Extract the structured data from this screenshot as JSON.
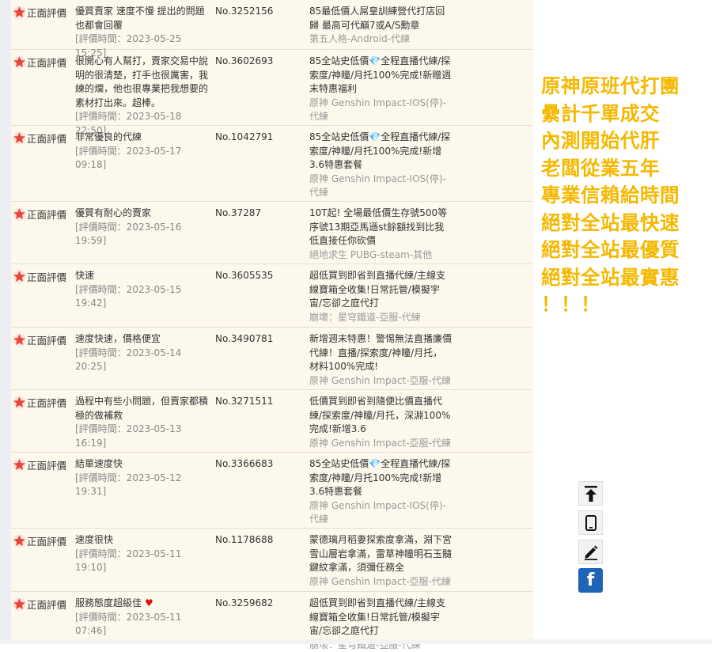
{
  "reviews": [
    {
      "rating": "正面評價",
      "comment": "優質賣家 速度不慢 提出的問題也都會回覆",
      "time": "[評價時間：2023-05-25 15:25]",
      "order_no": "No.3252156",
      "product_title": "85最低價人屌皇訓練營代打店回歸 最高可代巔7或A/S勳章",
      "product_game": "第五人格-Android-代練"
    },
    {
      "rating": "正面評價",
      "comment": "很開心有人幫打，賣家交易中說明的很清楚，打手也很厲害，我練的爛，他也很專業把我想要的素材打出來。超棒。",
      "time": "[評價時間：2023-05-18 22:50]",
      "order_no": "No.3602693",
      "product_title": "85全站史低價💎全程直播代練/探索度/神瞳/月托100%完成!新贈週末特惠福利",
      "product_game": "原神 Genshin Impact-IOS(停)-代練"
    },
    {
      "rating": "正面評價",
      "comment": "非常優良的代練",
      "time": "[評價時間：2023-05-17 09:18]",
      "order_no": "No.1042791",
      "product_title": "85全站史低價💎全程直播代練/探索度/神瞳/月托100%完成!新增3.6特惠套餐",
      "product_game": "原神 Genshin Impact-IOS(停)-代練"
    },
    {
      "rating": "正面評價",
      "comment": "優質有耐心的賣家",
      "time": "[評價時間：2023-05-16 19:59]",
      "order_no": "No.37287",
      "product_title": "10T起! 全場最低價生存號500等序號13期亞馬遜st餘額找到比我低直接任你砍價",
      "product_game": "絕地求生 PUBG-steam-其他"
    },
    {
      "rating": "正面評價",
      "comment": "快速",
      "time": "[評價時間：2023-05-15 19:42]",
      "order_no": "No.3605535",
      "product_title": "超低買到即省到直播代練/主線支線寶箱全收集!日常託管/模擬宇宙/忘卻之庭代打",
      "product_game": "崩壞：星穹鐵道-亞服-代練"
    },
    {
      "rating": "正面評價",
      "comment": "速度快速，價格便宜",
      "time": "[評價時間：2023-05-14 20:25]",
      "order_no": "No.3490781",
      "product_title": "新增週末特惠！警惕無法直播廉價代練！直播/探索度/神瞳/月托，材料100%完成!",
      "product_game": "原神 Genshin Impact-亞服-代練"
    },
    {
      "rating": "正面評價",
      "comment": "過程中有些小問題，但賣家都積極的做補救",
      "time": "[評價時間：2023-05-13 16:19]",
      "order_no": "No.3271511",
      "product_title": "低價買到即省到隨便比價直播代練/探索度/神瞳/月托，深淵100%完成!新增3.6",
      "product_game": "原神 Genshin Impact-亞服-代練"
    },
    {
      "rating": "正面評價",
      "comment": "結單速度快",
      "time": "[評價時間：2023-05-12 19:31]",
      "order_no": "No.3366683",
      "product_title": "85全站史低價💎全程直播代練/探索度/神瞳/月托100%完成!新增3.6特惠套餐",
      "product_game": "原神 Genshin Impact-IOS(停)-代練"
    },
    {
      "rating": "正面評價",
      "comment": "速度很快",
      "time": "[評價時間：2023-05-11 19:10]",
      "order_no": "No.1178688",
      "product_title": "蒙德璃月稻妻探索度拿滿，淵下宮雪山層岩拿滿，雷草神瞳明石玉髓鍵紋拿滿，須彌任務全",
      "product_game": "原神 Genshin Impact-亞服-代練"
    },
    {
      "rating": "正面評價",
      "comment": "服務態度超級佳",
      "time": "[評價時間：2023-05-11 07:46]",
      "order_no": "No.3259682",
      "product_title": "超低買到即省到直播代練/主線支線寶箱全收集!日常託管/模擬宇宙/忘卻之庭代打",
      "product_game": "崩壞：星穹鐵道-亞服-代練"
    }
  ],
  "promo_lines": [
    "原神原班代打團",
    "纍計千單成交",
    "內測開始代肝",
    "老闆從業五年",
    "專業信賴給時間",
    "絕對全站最快速",
    "絕對全站最優質",
    "絕對全站最實惠",
    "！！！"
  ],
  "side_buttons": [
    {
      "icon": "scroll-to-top-icon"
    },
    {
      "icon": "mobile-icon"
    },
    {
      "icon": "pencil-edit-icon"
    },
    {
      "icon": "facebook-icon",
      "label": "f"
    }
  ],
  "colors": {
    "promo": "#f5b800",
    "row_background": "#fdf8ec",
    "star_badge": "#e8453c",
    "facebook": "#1f64b5"
  }
}
